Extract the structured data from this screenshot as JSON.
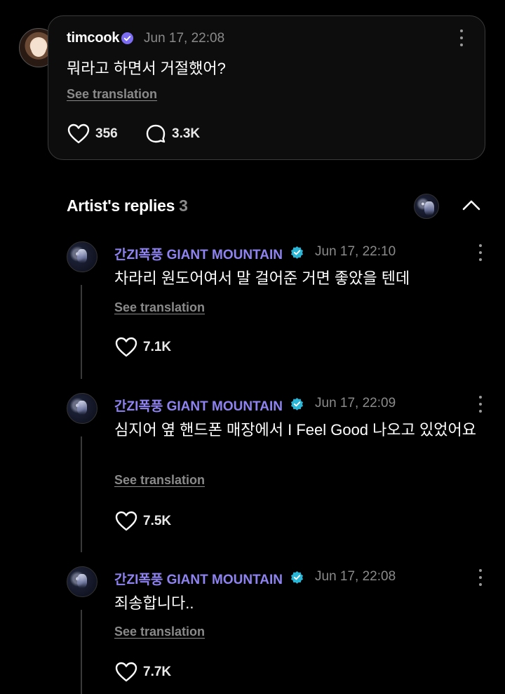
{
  "post": {
    "username": "timcook",
    "timestamp": "Jun 17, 22:08",
    "text": "뭐라고 하면서 거절했어?",
    "see_translation": "See translation",
    "likes": "356",
    "comments": "3.3K"
  },
  "artist_replies": {
    "title": "Artist's replies",
    "count": "3"
  },
  "replies": [
    {
      "username": "간ZI폭풍 GIANT MOUNTAIN",
      "timestamp": "Jun 17, 22:10",
      "text": "차라리 원도어여서 말 걸어준 거면 좋았을 텐데",
      "see_translation": "See translation",
      "likes": "7.1K"
    },
    {
      "username": "간ZI폭풍 GIANT MOUNTAIN",
      "timestamp": "Jun 17, 22:09",
      "text": "심지어 옆 핸드폰 매장에서 I Feel Good 나오고 있었어요",
      "see_translation": "See translation",
      "likes": "7.5K"
    },
    {
      "username": "간ZI폭풍 GIANT MOUNTAIN",
      "timestamp": "Jun 17, 22:08",
      "text": "죄송합니다..",
      "see_translation": "See translation",
      "likes": "7.7K"
    }
  ],
  "colors": {
    "artist_name": "#8e83f0",
    "verified_post": "#7c6cf2",
    "verified_artist": "#29b6d6"
  },
  "icons": [
    "heart-icon",
    "comment-icon",
    "verified-badge-icon",
    "more-options-icon",
    "chevron-up-icon"
  ]
}
